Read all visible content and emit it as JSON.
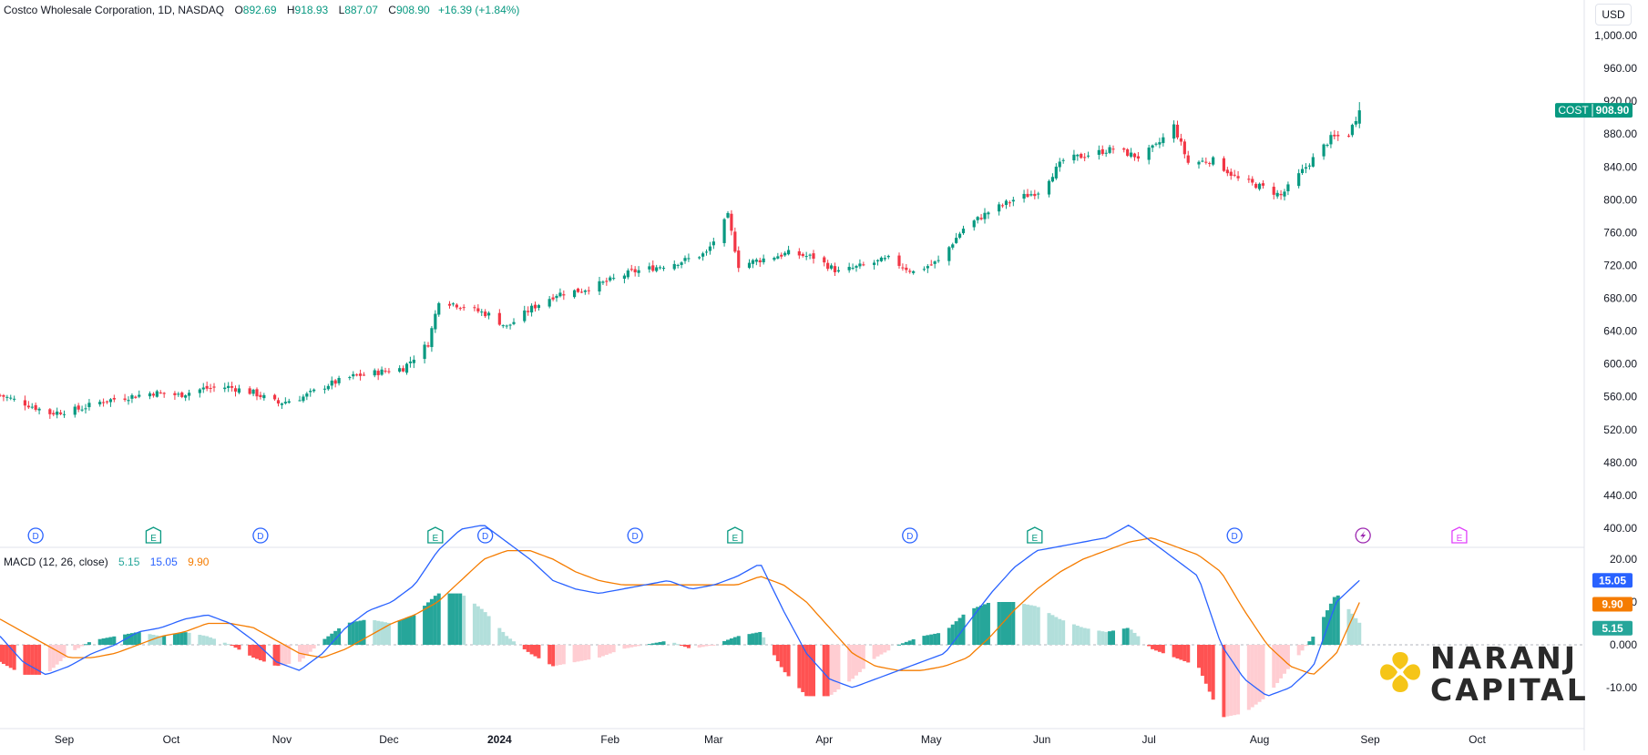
{
  "header": {
    "symbol": "Costco Wholesale Corporation, 1D, NASDAQ",
    "o_label": "O",
    "o_value": "892.69",
    "h_label": "H",
    "h_value": "918.93",
    "l_label": "L",
    "l_value": "887.07",
    "c_label": "C",
    "c_value": "908.90",
    "change": "+16.39 (+1.84%)"
  },
  "currency": "USD",
  "macd_header": {
    "label": "MACD (12, 26, close)",
    "hist": "5.15",
    "macd": "15.05",
    "signal": "9.90"
  },
  "logo": {
    "line1": "NARANJ",
    "line2": "CAPITAL"
  },
  "colors": {
    "up": "#089981",
    "down": "#f23645",
    "macd": "#2962ff",
    "signal": "#f57c00",
    "hist_up_strong": "#26a69a",
    "hist_up_weak": "#b2dfdb",
    "hist_down_strong": "#ff5252",
    "hist_down_weak": "#ffcdd2",
    "logo_yellow": "#f5c518"
  },
  "chart_data": [
    {
      "type": "candlestick",
      "ticker": "COST",
      "last_price": "908.90",
      "y_ticks": [
        "1,000.00",
        "960.00",
        "920.00",
        "880.00",
        "840.00",
        "800.00",
        "760.00",
        "720.00",
        "680.00",
        "640.00",
        "600.00",
        "560.00",
        "520.00",
        "480.00",
        "440.00",
        "400.00"
      ],
      "ylim": [
        400,
        1000
      ],
      "x_ticks": [
        {
          "label": "Sep",
          "date": "2023-09-01"
        },
        {
          "label": "Oct",
          "date": "2023-10-01"
        },
        {
          "label": "Nov",
          "date": "2023-11-01"
        },
        {
          "label": "Dec",
          "date": "2023-12-01"
        },
        {
          "label": "2024",
          "date": "2024-01-01"
        },
        {
          "label": "Feb",
          "date": "2024-02-01"
        },
        {
          "label": "Mar",
          "date": "2024-03-01"
        },
        {
          "label": "Apr",
          "date": "2024-04-01"
        },
        {
          "label": "May",
          "date": "2024-05-01"
        },
        {
          "label": "Jun",
          "date": "2024-06-01"
        },
        {
          "label": "Jul",
          "date": "2024-07-01"
        },
        {
          "label": "Aug",
          "date": "2024-08-01"
        },
        {
          "label": "Sep",
          "date": "2024-09-01"
        },
        {
          "label": "Oct",
          "date": "2024-10-01"
        }
      ],
      "start_date": "2023-08-14",
      "end_date": "2024-10-31",
      "close_path": [
        {
          "date": "2023-08-14",
          "close": 562
        },
        {
          "date": "2023-08-21",
          "close": 552
        },
        {
          "date": "2023-08-28",
          "close": 540
        },
        {
          "date": "2023-09-05",
          "close": 545
        },
        {
          "date": "2023-09-12",
          "close": 555
        },
        {
          "date": "2023-09-19",
          "close": 560
        },
        {
          "date": "2023-09-26",
          "close": 565
        },
        {
          "date": "2023-10-03",
          "close": 562
        },
        {
          "date": "2023-10-10",
          "close": 570
        },
        {
          "date": "2023-10-17",
          "close": 572
        },
        {
          "date": "2023-10-24",
          "close": 565
        },
        {
          "date": "2023-10-31",
          "close": 552
        },
        {
          "date": "2023-11-07",
          "close": 560
        },
        {
          "date": "2023-11-14",
          "close": 575
        },
        {
          "date": "2023-11-21",
          "close": 585
        },
        {
          "date": "2023-11-28",
          "close": 590
        },
        {
          "date": "2023-12-05",
          "close": 595
        },
        {
          "date": "2023-12-12",
          "close": 625
        },
        {
          "date": "2023-12-15",
          "close": 678
        },
        {
          "date": "2023-12-22",
          "close": 670
        },
        {
          "date": "2023-12-29",
          "close": 660
        },
        {
          "date": "2024-01-03",
          "close": 645
        },
        {
          "date": "2024-01-10",
          "close": 668
        },
        {
          "date": "2024-01-17",
          "close": 685
        },
        {
          "date": "2024-01-24",
          "close": 690
        },
        {
          "date": "2024-01-31",
          "close": 700
        },
        {
          "date": "2024-02-07",
          "close": 712
        },
        {
          "date": "2024-02-14",
          "close": 718
        },
        {
          "date": "2024-02-21",
          "close": 725
        },
        {
          "date": "2024-02-28",
          "close": 735
        },
        {
          "date": "2024-03-05",
          "close": 780
        },
        {
          "date": "2024-03-08",
          "close": 720
        },
        {
          "date": "2024-03-15",
          "close": 728
        },
        {
          "date": "2024-03-22",
          "close": 735
        },
        {
          "date": "2024-03-29",
          "close": 730
        },
        {
          "date": "2024-04-05",
          "close": 712
        },
        {
          "date": "2024-04-12",
          "close": 720
        },
        {
          "date": "2024-04-19",
          "close": 728
        },
        {
          "date": "2024-04-26",
          "close": 712
        },
        {
          "date": "2024-05-03",
          "close": 725
        },
        {
          "date": "2024-05-10",
          "close": 765
        },
        {
          "date": "2024-05-17",
          "close": 785
        },
        {
          "date": "2024-05-24",
          "close": 800
        },
        {
          "date": "2024-05-31",
          "close": 810
        },
        {
          "date": "2024-06-07",
          "close": 848
        },
        {
          "date": "2024-06-14",
          "close": 855
        },
        {
          "date": "2024-06-21",
          "close": 862
        },
        {
          "date": "2024-06-28",
          "close": 852
        },
        {
          "date": "2024-07-03",
          "close": 865
        },
        {
          "date": "2024-07-08",
          "close": 890
        },
        {
          "date": "2024-07-12",
          "close": 845
        },
        {
          "date": "2024-07-19",
          "close": 848
        },
        {
          "date": "2024-07-26",
          "close": 825
        },
        {
          "date": "2024-08-02",
          "close": 815
        },
        {
          "date": "2024-08-07",
          "close": 805
        },
        {
          "date": "2024-08-14",
          "close": 840
        },
        {
          "date": "2024-08-21",
          "close": 875
        },
        {
          "date": "2024-08-26",
          "close": 880
        },
        {
          "date": "2024-08-29",
          "close": 908.9
        }
      ],
      "events": [
        {
          "type": "D",
          "date": "2023-08-24"
        },
        {
          "type": "E",
          "date": "2023-09-26"
        },
        {
          "type": "D",
          "date": "2023-10-26"
        },
        {
          "type": "E",
          "date": "2023-12-14"
        },
        {
          "type": "D",
          "date": "2023-12-28"
        },
        {
          "type": "D",
          "date": "2024-02-08"
        },
        {
          "type": "E",
          "date": "2024-03-07"
        },
        {
          "type": "D",
          "date": "2024-04-25"
        },
        {
          "type": "E",
          "date": "2024-05-30"
        },
        {
          "type": "D",
          "date": "2024-07-25"
        },
        {
          "type": "S",
          "date": "2024-08-30"
        },
        {
          "type": "E",
          "date": "2024-09-26"
        }
      ]
    },
    {
      "type": "line",
      "name": "MACD (12, 26, close)",
      "series": [
        {
          "name": "MACD",
          "values": [
            2,
            -4,
            -7,
            -5,
            -2,
            0,
            3,
            4,
            6,
            7,
            5,
            1,
            -4,
            -6,
            -2,
            4,
            8,
            10,
            14,
            22,
            27,
            28,
            24,
            20,
            15,
            13,
            12,
            13,
            14,
            15,
            13,
            14,
            16,
            19,
            8,
            -2,
            -8,
            -10,
            -8,
            -6,
            -4,
            -2,
            5,
            12,
            18,
            22,
            23,
            24,
            25,
            28,
            24,
            20,
            16,
            0,
            -8,
            -12,
            -10,
            -5,
            10,
            15.05
          ]
        },
        {
          "name": "Signal",
          "values": [
            6,
            3,
            0,
            -3,
            -3,
            -2,
            0,
            2,
            3,
            5,
            5,
            4,
            1,
            -2,
            -3,
            -1,
            2,
            5,
            7,
            10,
            15,
            20,
            22,
            22,
            20,
            17,
            15,
            14,
            14,
            14,
            14,
            14,
            14,
            16,
            14,
            10,
            4,
            -2,
            -5,
            -6,
            -6,
            -5,
            -3,
            2,
            8,
            13,
            17,
            20,
            22,
            24,
            25,
            23,
            21,
            17,
            8,
            0,
            -5,
            -7,
            -2,
            9.9
          ]
        },
        {
          "name": "Histogram",
          "values": [
            -4,
            -7,
            -7,
            -2,
            1,
            2,
            3,
            2,
            3,
            2,
            0,
            -3,
            -5,
            -4,
            1,
            5,
            6,
            5,
            7,
            12,
            12,
            8,
            2,
            -2,
            -5,
            -4,
            -3,
            -1,
            0,
            1,
            -1,
            0,
            2,
            3,
            -6,
            -12,
            -12,
            -8,
            -3,
            0,
            2,
            3,
            8,
            10,
            10,
            9,
            6,
            4,
            3,
            4,
            -1,
            -3,
            -5,
            -17,
            -16,
            -12,
            -5,
            2,
            12,
            5.15
          ]
        }
      ],
      "y_ticks": [
        "20.00",
        "10.00",
        "0.000",
        "-10.00"
      ],
      "ylim": [
        -14,
        28
      ],
      "last_values": {
        "macd": "15.05",
        "signal": "9.90",
        "hist": "5.15"
      }
    }
  ]
}
